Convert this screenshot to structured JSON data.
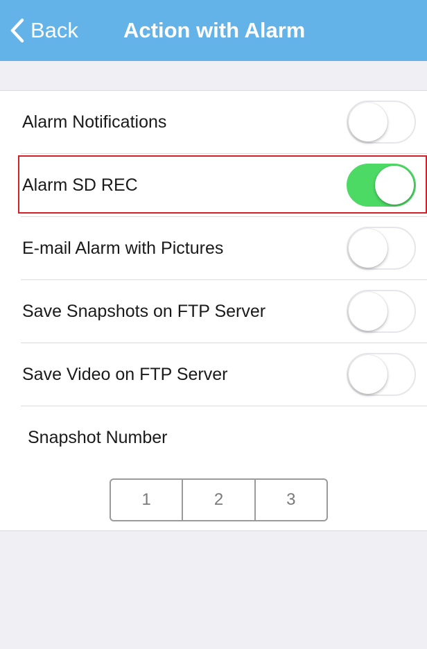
{
  "nav": {
    "back_label": "Back",
    "title": "Action with Alarm",
    "color": "#63b3e8"
  },
  "settings": [
    {
      "label": "Alarm Notifications",
      "enabled": false
    },
    {
      "label": "Alarm SD REC",
      "enabled": true,
      "highlighted": true
    },
    {
      "label": "E-mail Alarm with Pictures",
      "enabled": false
    },
    {
      "label": "Save Snapshots on FTP Server",
      "enabled": false
    },
    {
      "label": "Save Video on FTP Server",
      "enabled": false
    }
  ],
  "snapshot": {
    "label": "Snapshot Number",
    "options": [
      "1",
      "2",
      "3"
    ]
  },
  "colors": {
    "toggle_on": "#4cd964",
    "highlight": "#d21f2a"
  }
}
